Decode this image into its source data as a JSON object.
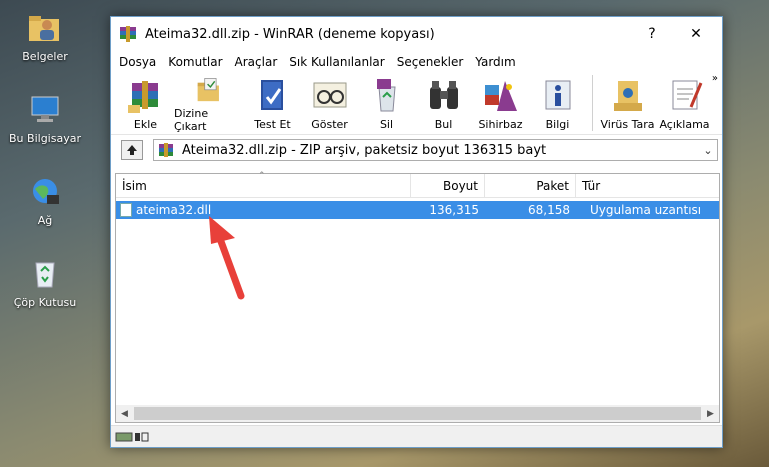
{
  "desktop": {
    "icons": [
      {
        "label": "Belgeler",
        "icon": "folder-user-icon"
      },
      {
        "label": "Bu Bilgisayar",
        "icon": "computer-icon"
      },
      {
        "label": "Ağ",
        "icon": "network-globe-icon"
      },
      {
        "label": "Çöp Kutusu",
        "icon": "recycle-bin-icon"
      }
    ]
  },
  "window": {
    "title": "Ateima32.dll.zip - WinRAR (deneme kopyası)",
    "help_label": "?",
    "close_label": "✕",
    "menu": [
      "Dosya",
      "Komutlar",
      "Araçlar",
      "Sık Kullanılanlar",
      "Seçenekler",
      "Yardım"
    ],
    "toolbar": [
      {
        "label": "Ekle",
        "icon": "add-archive-icon"
      },
      {
        "label": "Dizine Çıkart",
        "icon": "extract-folder-icon"
      },
      {
        "label": "Test Et",
        "icon": "test-book-icon"
      },
      {
        "label": "Göster",
        "icon": "view-glasses-icon"
      },
      {
        "label": "Sil",
        "icon": "delete-recycle-icon"
      },
      {
        "label": "Bul",
        "icon": "find-binoculars-icon"
      },
      {
        "label": "Sihirbaz",
        "icon": "wizard-icon"
      },
      {
        "label": "Bilgi",
        "icon": "info-icon"
      },
      {
        "label": "Virüs Tara",
        "icon": "virus-scan-icon"
      },
      {
        "label": "Açıklama",
        "icon": "comment-icon"
      }
    ],
    "more_label": "»",
    "address": "Ateima32.dll.zip - ZIP arşiv, paketsiz boyut 136315 bayt",
    "columns": {
      "name": "İsim",
      "size": "Boyut",
      "packed": "Paket",
      "type": "Tür"
    },
    "files": [
      {
        "name": "ateima32.dll",
        "size": "136,315",
        "packed": "68,158",
        "type": "Uygulama uzantısı",
        "selected": true
      }
    ]
  },
  "colors": {
    "selection": "#3a8ee6",
    "arrow": "#e8403a"
  }
}
